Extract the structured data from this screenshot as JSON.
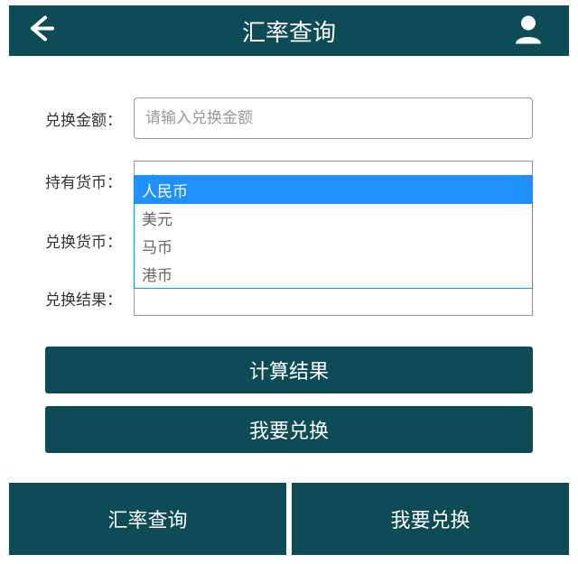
{
  "header": {
    "title": "汇率查询"
  },
  "labels": {
    "amount": "兑换金额：",
    "holdCurrency": "持有货币：",
    "exchangeCurrency": "兑换货币：",
    "result": "兑换结果："
  },
  "fields": {
    "amount": {
      "value": "",
      "placeholder": "请输入兑换金额"
    },
    "holdCurrency": {
      "selected": "人民币"
    },
    "exchangeCurrency": {
      "selected": ""
    },
    "result": {
      "value": ""
    }
  },
  "dropdown": {
    "options": [
      "人民币",
      "美元",
      "马币",
      "港币"
    ],
    "highlighted": "人民币"
  },
  "buttons": {
    "calculate": "计算结果",
    "wantExchange": "我要兑换"
  },
  "bottomTabs": {
    "left": "汇率查询",
    "right": "我要兑换"
  }
}
